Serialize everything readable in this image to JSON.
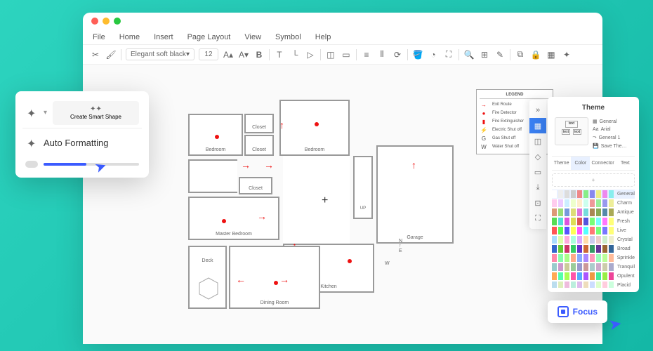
{
  "menubar": [
    "File",
    "Home",
    "Insert",
    "Page Layout",
    "View",
    "Symbol",
    "Help"
  ],
  "font": {
    "name": "Elegant soft black",
    "size": "12"
  },
  "legend": {
    "title": "LEGEND",
    "rows": [
      {
        "sym": "→",
        "color": "#e11",
        "label": "Exit Route"
      },
      {
        "sym": "●",
        "color": "#e11",
        "label": "Fire Detector"
      },
      {
        "sym": "▮",
        "color": "#e11",
        "label": "Fire Extinguisher"
      },
      {
        "sym": "⚡",
        "color": "#555",
        "label": "Electric Shut off"
      },
      {
        "sym": "G",
        "color": "#555",
        "label": "Gas Shut off"
      },
      {
        "sym": "W",
        "color": "#555",
        "label": "Water Shut off"
      }
    ]
  },
  "rooms": {
    "bedroom1": "Bedroom",
    "closet1": "Closet",
    "closet2": "Closet",
    "bedroom2": "Bedroom",
    "closet3": "Closet",
    "master": "Master Bedroom",
    "garage": "Garage",
    "up": "UP",
    "kitchen": "Kitchen",
    "deck": "Deck",
    "dining": "Dining Room",
    "compass": {
      "n": "N",
      "e": "E",
      "w": "W"
    }
  },
  "popup": {
    "smart": "Create Smart Shape",
    "main": "Auto Formatting"
  },
  "theme": {
    "title": "Theme",
    "tabs": [
      "Theme",
      "Color",
      "Connector",
      "Text"
    ],
    "opts": [
      {
        "ico": "▦",
        "label": "General"
      },
      {
        "ico": "Aa",
        "label": "Arial"
      },
      {
        "ico": "⤳",
        "label": "General 1"
      },
      {
        "ico": "💾",
        "label": "Save The…"
      }
    ],
    "palettes": [
      "General",
      "Charm",
      "Antique",
      "Fresh",
      "Live",
      "Crystal",
      "Broad",
      "Sprinkle",
      "Tranquil",
      "Opulent",
      "Placid"
    ],
    "previewText": "text"
  },
  "focus": "Focus"
}
